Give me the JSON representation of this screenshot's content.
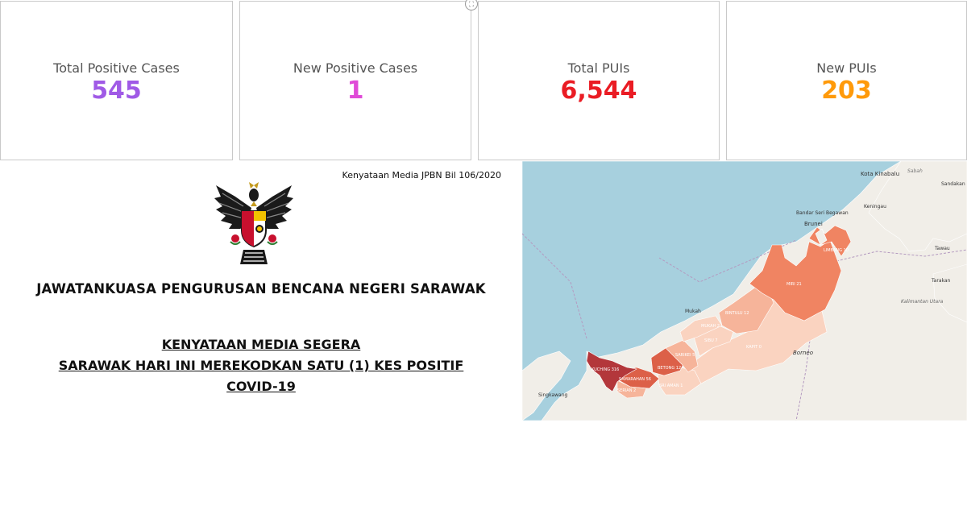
{
  "stats": [
    {
      "label": "Total Positive Cases",
      "value": "545",
      "color": "#a05ae6"
    },
    {
      "label": "New Positive Cases",
      "value": "1",
      "color": "#e04ad8"
    },
    {
      "label": "Total PUIs",
      "value": "6,544",
      "color": "#ea1c24"
    },
    {
      "label": "New PUIs",
      "value": "203",
      "color": "#ff9a0a"
    }
  ],
  "document": {
    "reference": "Kenyataan Media JPBN Bil 106/2020",
    "committee": "JAWATANKUASA PENGURUSAN BENCANA NEGERI SARAWAK",
    "heading_lines": [
      "KENYATAAN MEDIA SEGERA",
      "SARAWAK HARI INI  MEREKODKAN SATU (1) KES POSITIF",
      "COVID-19"
    ]
  },
  "map": {
    "places": {
      "kota_kinabalu": "Kota Kinabalu",
      "sabah": "Sabah",
      "sandakan": "Sandakan",
      "keningau": "Keningau",
      "bandar_seri_begawan": "Bandar Seri Begawan",
      "brunei": "Brunei",
      "tawau": "Tawau",
      "tarakan": "Tarakan",
      "kalimantan_utara": "Kalimantan Utara",
      "mukah": "Mukah",
      "borneo": "Borneo",
      "singkawang": "Singkawang"
    },
    "divisions": [
      {
        "name": "LIMBANG 10"
      },
      {
        "name": "MIRI 21"
      },
      {
        "name": "BINTULU 12"
      },
      {
        "name": "MUKAH 2"
      },
      {
        "name": "SIBU 7"
      },
      {
        "name": "SARIKEI 5"
      },
      {
        "name": "BETONG 12"
      },
      {
        "name": "KAPIT 0"
      },
      {
        "name": "KUCHING 316"
      },
      {
        "name": "SAMARAHAN 56"
      },
      {
        "name": "SERIAN 2"
      },
      {
        "name": "SRI AMAN 1"
      }
    ],
    "colors": {
      "sea": "#a7d0de",
      "land": "#f1eee8",
      "highest": "#b3373b",
      "high": "#dc6048",
      "medium": "#f08462",
      "low": "#f6b49a",
      "lowest": "#fad3c0"
    }
  }
}
